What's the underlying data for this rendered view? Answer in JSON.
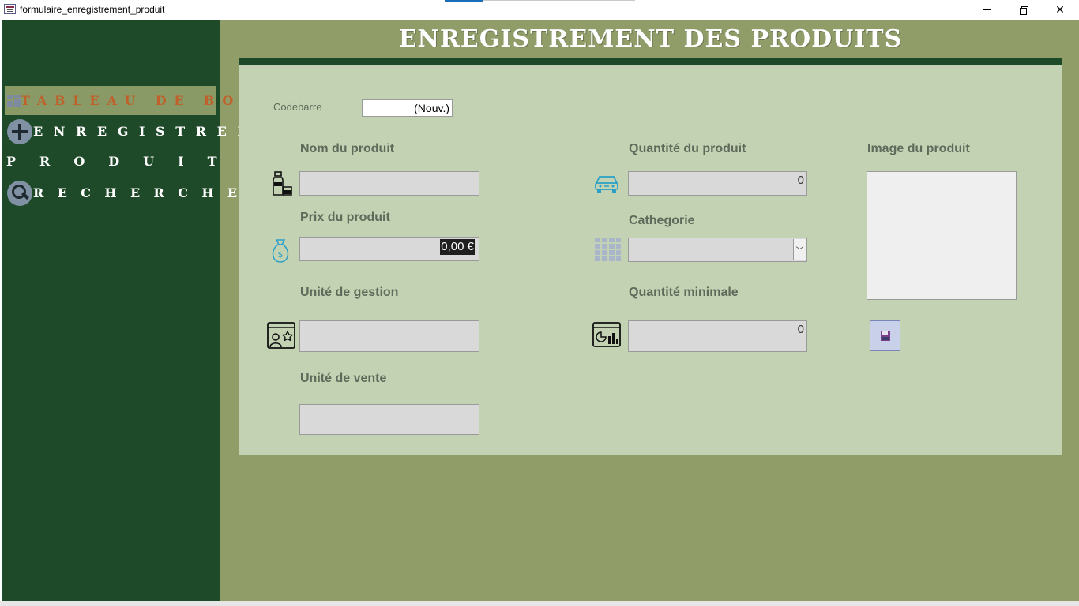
{
  "window": {
    "title": "formulaire_enregistrement_produit",
    "minimize_glyph": "—",
    "close_glyph": "✕"
  },
  "sidebar": {
    "items": [
      {
        "label": "TABLEAU DE BORD",
        "icon": "dashboard-icon",
        "active": true
      },
      {
        "label": "ENREGISTRER",
        "icon": "plus-icon"
      },
      {
        "label": "PRODUITS"
      },
      {
        "label": "RECHERCHE",
        "icon": "search-icon"
      }
    ],
    "active_color": "#c0602a"
  },
  "header": {
    "title": "ENREGISTREMENT DES PRODUITS"
  },
  "form": {
    "codebarre": {
      "label": "Codebarre",
      "value": "(Nouv.)"
    },
    "nom_produit": {
      "label": "Nom du produit",
      "value": ""
    },
    "prix_produit": {
      "label": "Prix du produit",
      "value": "0,00 €"
    },
    "unite_gestion": {
      "label": "Unité de gestion",
      "value": ""
    },
    "unite_vente": {
      "label": "Unité de vente",
      "value": ""
    },
    "quantite_produit": {
      "label": "Quantité du produit",
      "value": "0"
    },
    "categorie": {
      "label": "Cathegorie",
      "value": "",
      "dropdown_glyph": "﹀"
    },
    "quantite_minimale": {
      "label": "Quantité minimale",
      "value": "0"
    },
    "image_produit": {
      "label": "Image du produit"
    }
  },
  "colors": {
    "sidebar_bg": "#1f4a29",
    "form_bg": "#919d68",
    "panel_bg": "#c3d2b3"
  }
}
